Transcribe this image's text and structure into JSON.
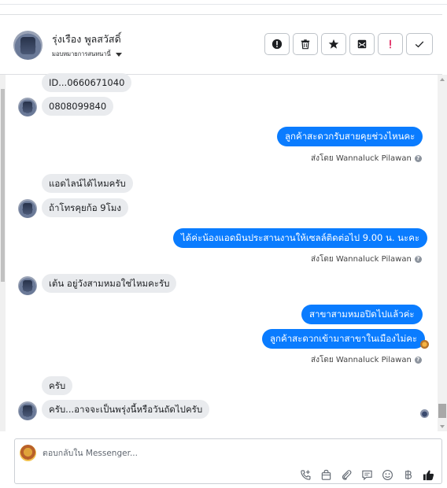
{
  "contact": {
    "name": "รุ่งเรือง พูลสวัสดิ์",
    "assign_label": "มอบหมายการสนทนานี้"
  },
  "header_actions": [
    {
      "icon": "alert-circle-icon"
    },
    {
      "icon": "trash-icon"
    },
    {
      "icon": "star-icon"
    },
    {
      "icon": "envelope-icon"
    },
    {
      "icon": "exclamation-icon"
    },
    {
      "icon": "check-icon"
    }
  ],
  "messages": [
    {
      "side": "in",
      "text": "ID...0660671040"
    },
    {
      "side": "in",
      "text": "0808099840"
    },
    {
      "side": "out",
      "text": "ลูกค้าสะดวกรับสายคุยช่วงไหนคะ"
    },
    {
      "side": "sent",
      "text": "ส่งโดย Wannaluck Pilawan"
    },
    {
      "side": "in",
      "text": "แอดไลน์ได้ไหมครับ"
    },
    {
      "side": "in",
      "text": "ถ้าโทรคุยก้อ  9โมง"
    },
    {
      "side": "out",
      "text": "ได้ค่ะน้องแอดมินประสานงานให้เซลล์ติดต่อไป 9.00 น.  นะคะ"
    },
    {
      "side": "sent",
      "text": "ส่งโดย Wannaluck Pilawan"
    },
    {
      "side": "in",
      "text": "เต้น อยู่วังสามหมอใช่ไหมคะรับ"
    },
    {
      "side": "out",
      "text": "สาขาสามหมอปิดไปแล้วค่ะ"
    },
    {
      "side": "out",
      "text": "ลูกค้าสะดวกเข้ามาสาขาในเมืองไม่คะ"
    },
    {
      "side": "sent",
      "text": "ส่งโดย Wannaluck Pilawan"
    },
    {
      "side": "in",
      "text": "ครับ"
    },
    {
      "side": "in",
      "text": "ครับ...อาจจะเป็นพรุ่งนี้หรือวันถัดไปครับ"
    }
  ],
  "composer": {
    "placeholder": "ตอบกลับใน Messenger...",
    "tools": [
      "phone-plus-icon",
      "bag-icon",
      "paperclip-icon",
      "saved-reply-icon",
      "smiley-icon",
      "baht-icon",
      "thumbs-up-icon"
    ]
  },
  "colors": {
    "outgoing_bubble": "#0a7cff",
    "incoming_bubble": "#e9ebee"
  }
}
